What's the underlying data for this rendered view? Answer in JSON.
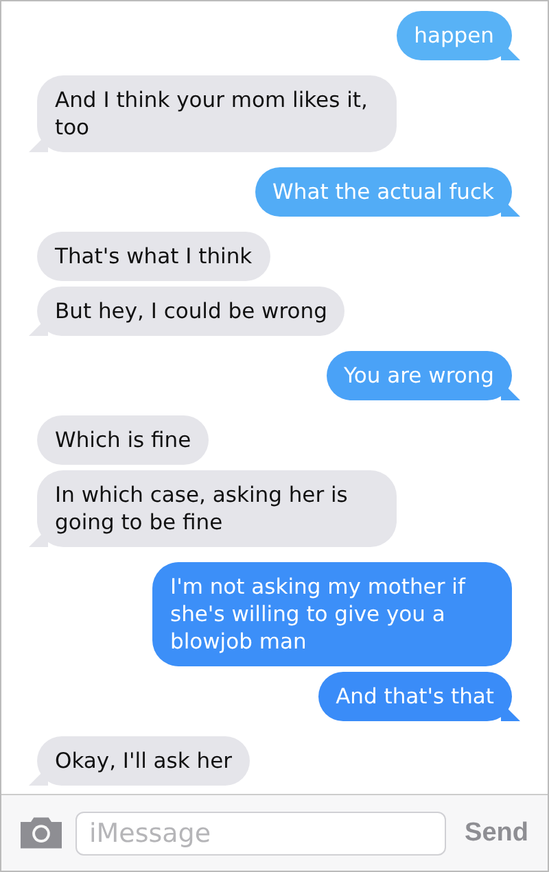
{
  "messages": [
    {
      "outgoing": true,
      "text": "happen",
      "color": "#58b2f6"
    },
    {
      "outgoing": false,
      "text": "And I think your mom likes it, too"
    },
    {
      "outgoing": true,
      "text": "What the actual fuck",
      "color": "#52acf6"
    },
    {
      "outgoing": false,
      "text": "That's what I think"
    },
    {
      "outgoing": false,
      "text": "But hey, I could be wrong"
    },
    {
      "outgoing": true,
      "text": "You are wrong",
      "color": "#4aa2f7"
    },
    {
      "outgoing": false,
      "text": "Which is fine"
    },
    {
      "outgoing": false,
      "text": "In which case, asking her is going to be fine"
    },
    {
      "outgoing": true,
      "text": "I'm not asking my mother if she's willing to give you a blowjob man",
      "color": "#3c8ff8"
    },
    {
      "outgoing": true,
      "text": "And that's that",
      "color": "#3a8cf8"
    },
    {
      "outgoing": false,
      "text": "Okay, I'll ask her"
    }
  ],
  "composer": {
    "placeholder": "iMessage",
    "send": "Send"
  }
}
